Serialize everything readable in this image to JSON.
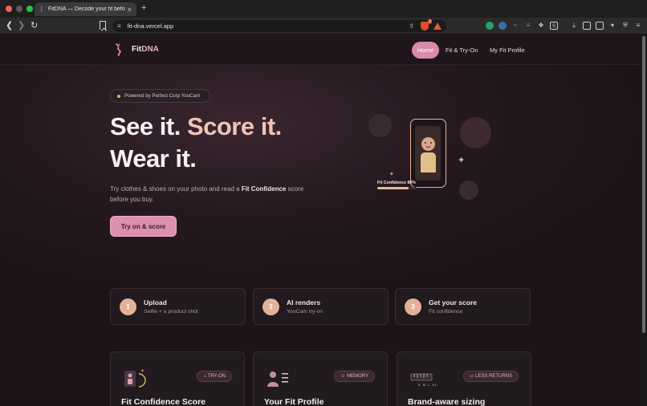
{
  "browser": {
    "tab_title": "FitDNA — Decode your fit befo",
    "tab_close": "×",
    "new_tab": "+",
    "url": "fit-dna.vercel.app",
    "brave_count": "3"
  },
  "header": {
    "logo_fit": "Fit",
    "logo_dna": "DNA",
    "nav": {
      "home": "Home",
      "fit_try_on": "Fit & Try-On",
      "profile": "My Fit Profile"
    }
  },
  "hero": {
    "pill": "Powered by Perfect Corp YouCam",
    "line1_a": "See it. ",
    "line1_b": "Score it.",
    "line2": "Wear it.",
    "sub_a": "Try clothes & shoes on your photo and read a ",
    "sub_bold": "Fit Confidence",
    "sub_b": " score before you buy.",
    "cta": "Try on & score",
    "fit_label": "Fit Confidence 80%",
    "fit_value": 0.8
  },
  "steps": [
    {
      "num": "1",
      "title": "Upload",
      "sub": "Selfie + a product shot"
    },
    {
      "num": "2",
      "title": "AI renders",
      "sub": "YouCam try-on"
    },
    {
      "num": "3",
      "title": "Get your score",
      "sub": "Fit confidence"
    }
  ],
  "features": [
    {
      "badge": "TRY-ON",
      "badge_icon": "tag-icon",
      "title": "Fit Confidence Score"
    },
    {
      "badge": "MEMORY",
      "badge_icon": "user-icon",
      "title": "Your Fit Profile"
    },
    {
      "badge": "LESS RETURNS",
      "badge_icon": "box-icon",
      "title": "Brand-aware sizing",
      "sizes": "S M L XL"
    }
  ],
  "colors": {
    "accent_pink": "#dc8fae",
    "accent_peach": "#f0c3b4",
    "background": "#1c1418"
  }
}
